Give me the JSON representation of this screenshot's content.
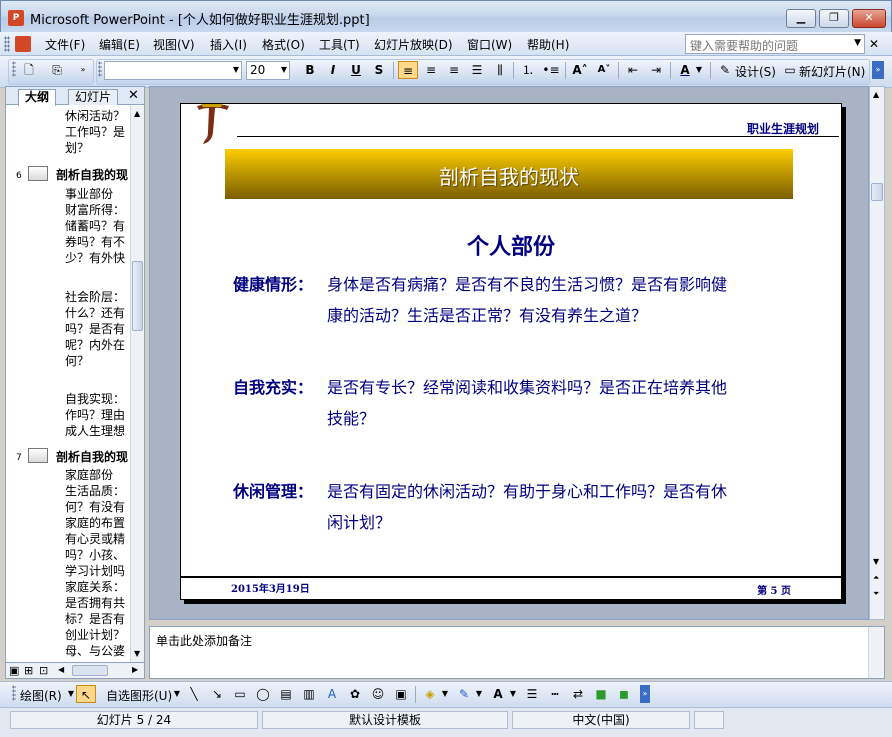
{
  "window": {
    "title": "Microsoft PowerPoint - [个人如何做好职业生涯规划.ppt]",
    "app_icon_glyph": "P"
  },
  "menu": {
    "items": [
      "文件(F)",
      "编辑(E)",
      "视图(V)",
      "插入(I)",
      "格式(O)",
      "工具(T)",
      "幻灯片放映(D)",
      "窗口(W)",
      "帮助(H)"
    ],
    "help_placeholder": "键入需要帮助的问题"
  },
  "toolbar": {
    "font_name": "",
    "font_size": "20",
    "bold_label": "B",
    "italic_label": "I",
    "underline_label": "U",
    "shadow_label": "S",
    "design_label": "设计(S)",
    "new_slide_label": "新幻灯片(N)"
  },
  "left_pane": {
    "tabs": [
      "大纲",
      "幻灯片"
    ],
    "outline": {
      "top_lines": [
        "休闲活动？",
        "工作吗？是",
        "划？"
      ],
      "slide6": {
        "number": "6",
        "title": "剖析自我的现",
        "lines_a": [
          "事业部份",
          "财富所得：",
          "储蓄吗？有",
          "券吗？有不",
          "少？有外快"
        ],
        "lines_b": [
          "社会阶层：",
          "什么？还有",
          "吗？是否有",
          "呢？内外在",
          "何？"
        ],
        "lines_c": [
          "自我实现：",
          "作吗？理由",
          "成人生理想"
        ]
      },
      "slide7": {
        "number": "7",
        "title": "剖析自我的现",
        "lines": [
          "家庭部份",
          "生活品质：",
          "何？有没有",
          "家庭的布置",
          "有心灵或精",
          "吗？小孩、",
          "学习计划吗",
          "家庭关系：",
          "是否拥有共",
          "标？是否有",
          "创业计划？",
          "母、与公婆"
        ]
      }
    }
  },
  "slide": {
    "header": "职业生涯规划",
    "banner": "剖析自我的现状",
    "subtitle": "个人部份",
    "items": [
      {
        "label": "健康情形：",
        "line1": "身体是否有病痛？是否有不良的生活习惯？是否有影响健",
        "line2": "康的活动？生活是否正常？有没有养生之道？"
      },
      {
        "label": "自我充实：",
        "line1": "是否有专长？经常阅读和收集资料吗？是否正在培养其他",
        "line2": "技能？"
      },
      {
        "label": "休闲管理：",
        "line1": "是否有固定的休闲活动？有助于身心和工作吗？是否有休",
        "line2": "闲计划？"
      }
    ],
    "footer_date": "2015年3月19日",
    "footer_page": "第 5 页"
  },
  "notes": {
    "placeholder": "单击此处添加备注"
  },
  "drawing_toolbar": {
    "draw_label": "绘图(R)",
    "autoshapes_label": "自选图形(U)"
  },
  "status": {
    "slide_info": "幻灯片 5 / 24",
    "template": "默认设计模板",
    "language": "中文(中国)"
  },
  "colors": {
    "slide_text": "#000080",
    "banner_top": "#ffcc00",
    "banner_bottom": "#7a5e00",
    "workspace": "#a8b4c6"
  }
}
